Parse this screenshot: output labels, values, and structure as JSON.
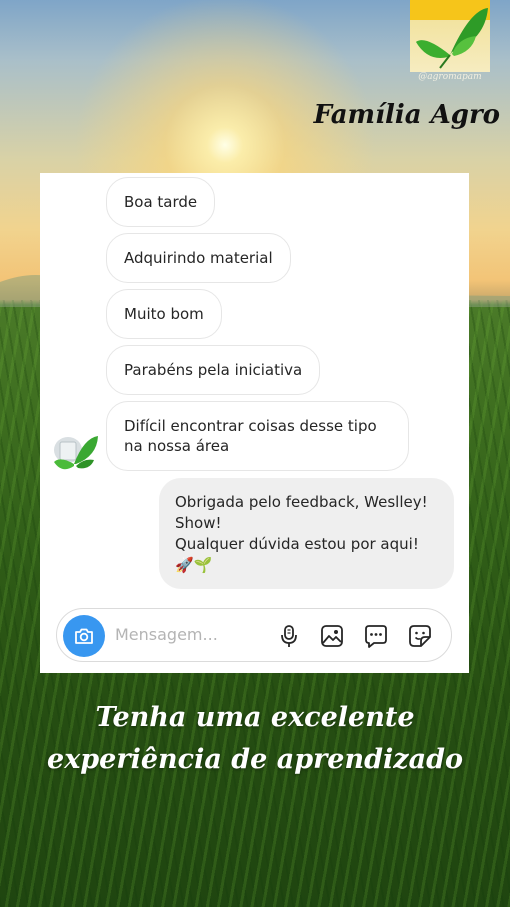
{
  "logo": {
    "handle": "@agromapam",
    "icon": "leaf-icon"
  },
  "brand": {
    "title": "Família Agro"
  },
  "chat": {
    "incoming": [
      {
        "text": "Boa tarde"
      },
      {
        "text": "Adquirindo material"
      },
      {
        "text": "Muito bom"
      },
      {
        "text": "Parabéns pela iniciativa"
      },
      {
        "line1": "Difícil encontrar coisas desse tipo",
        "line2": "na nossa área"
      }
    ],
    "outgoing": {
      "line1": "Obrigada pelo feedback, Weslley!",
      "line2": "Show!",
      "line3": "Qualquer dúvida estou por aqui!",
      "emoji": "🚀🌱"
    }
  },
  "composer": {
    "placeholder": "Mensagem...",
    "icons": [
      "camera-icon",
      "microphone-icon",
      "image-icon",
      "chat-options-icon",
      "sticker-icon"
    ],
    "accent": "#3897f0"
  },
  "slogan": {
    "line1": "Tenha uma excelente",
    "line2": "experiência de aprendizado"
  }
}
